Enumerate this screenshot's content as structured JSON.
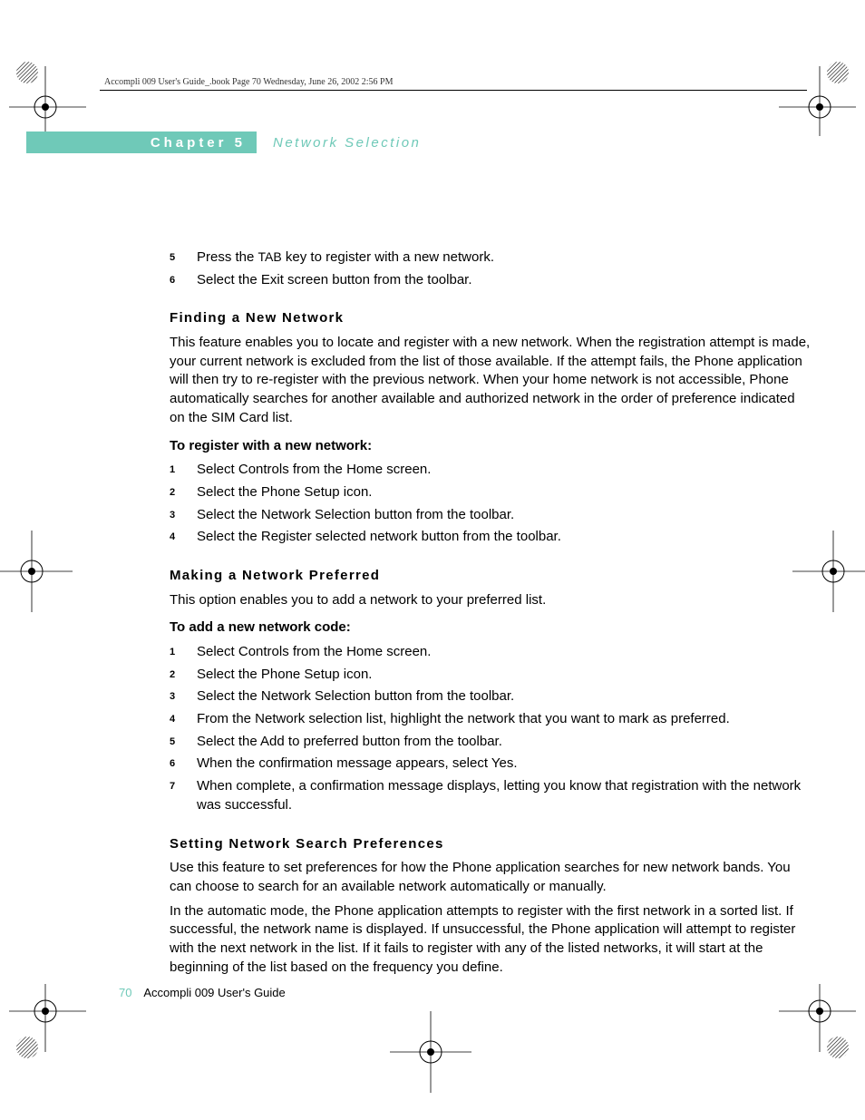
{
  "header": {
    "runningHead": "Accompli 009 User's Guide_.book  Page 70  Wednesday, June 26, 2002  2:56 PM"
  },
  "chapter": {
    "label": "Chapter 5",
    "title": "Network Selection"
  },
  "continuedSteps": {
    "items": [
      {
        "n": "5",
        "pre": "Press the ",
        "key": "TAB",
        "post": " key to register with a new network."
      },
      {
        "n": "6",
        "text": "Select the Exit screen button from the toolbar."
      }
    ]
  },
  "sections": [
    {
      "heading": "Finding a New Network",
      "paragraphs": [
        "This feature enables you to locate and register with a new network. When the registration attempt is made, your current network is excluded from the list of those available. If the attempt fails, the Phone application will then try to re-register with the previous network. When your home network is not accessible, Phone automatically searches for another available and authorized network in the order of preference indicated on the SIM Card list."
      ],
      "subheading": "To register with a new network:",
      "steps": [
        "Select Controls from the Home screen.",
        "Select the Phone Setup icon.",
        "Select the Network Selection button from the toolbar.",
        "Select the Register selected network button from the toolbar."
      ]
    },
    {
      "heading": "Making a Network Preferred",
      "paragraphs": [
        "This option enables you to add a network to your preferred list."
      ],
      "subheading": "To add a new network code:",
      "steps": [
        "Select Controls from the Home screen.",
        "Select the Phone Setup icon.",
        "Select the Network Selection button from the toolbar.",
        "From the Network selection list, highlight the network that you want to mark as preferred.",
        "Select the Add to preferred button from the toolbar.",
        "When the confirmation message appears, select Yes.",
        "When complete, a confirmation message displays, letting you know that registration with the network was successful."
      ]
    },
    {
      "heading": "Setting Network Search Preferences",
      "paragraphs": [
        "Use this feature to set preferences for how the Phone application searches for new network bands. You can choose to search for an available network automatically or manually.",
        "In the automatic mode, the Phone application attempts to register with the first network in a sorted list. If successful, the network name is displayed. If unsuccessful, the Phone application will attempt to register with the next network in the list.  If it fails to register with any of the listed networks, it will start at the beginning of the list based on the frequency you define."
      ]
    }
  ],
  "footer": {
    "page": "70",
    "title": "Accompli 009 User's Guide"
  }
}
